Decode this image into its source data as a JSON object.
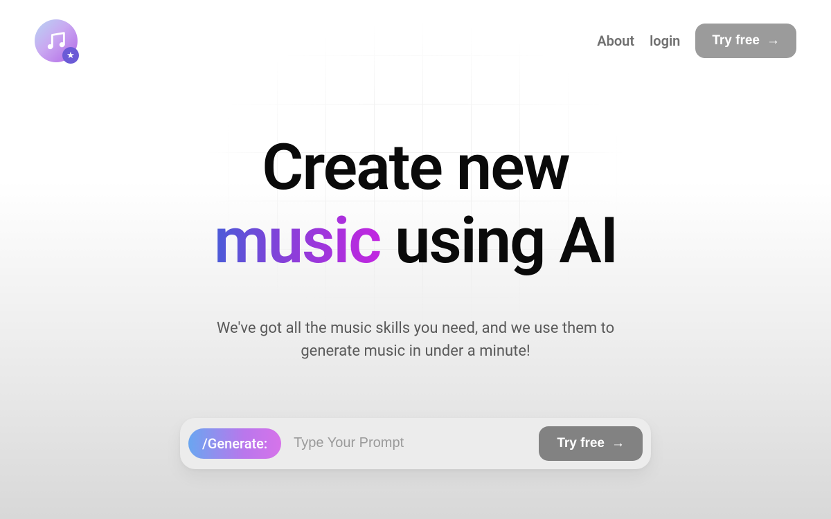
{
  "header": {
    "nav": {
      "about": "About",
      "login": "login"
    },
    "cta_label": "Try free"
  },
  "hero": {
    "title_line1": "Create new",
    "title_accent": "music",
    "title_line2_rest": "using AI",
    "subtitle": "We've got all the music skills you need, and we use them to generate music in under a minute!"
  },
  "prompt": {
    "generate_label": "/Generate:",
    "placeholder": "Type Your Prompt",
    "cta_label": "Try free"
  },
  "icons": {
    "arrow": "→",
    "star": "★"
  },
  "colors": {
    "cta_bg": "#9b9b9b",
    "accent_gradient_start": "#4a5bd8",
    "accent_gradient_end": "#c226e0"
  }
}
